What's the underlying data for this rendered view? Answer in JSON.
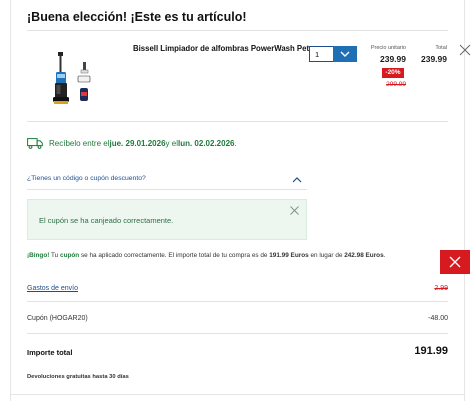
{
  "header": {
    "title": "¡Buena elección! ¡Este es tu artículo!"
  },
  "product": {
    "name": "Bissell Limpiador de alfombras PowerWash Pet",
    "image_icon": "carpet-cleaner-image",
    "quantity": "1",
    "unit_price_label": "Precio unitario",
    "unit_price": "239.99",
    "discount_badge": "-20%",
    "original_price": "299.99",
    "total_label": "Total",
    "total_price": "239.99"
  },
  "delivery": {
    "prefix": "Recíbelo entre el ",
    "date_from": "jue. 29.01.2026",
    "middle": " y el ",
    "date_to": "lun. 02.02.2026",
    "suffix": "."
  },
  "coupon": {
    "toggle_label": "¿Tienes un código o cupón descuento?",
    "success_message": "El cupón se ha canjeado correctamente."
  },
  "bingo": {
    "lead": "¡Bingo!",
    "part1": " Tu ",
    "cupon_word": "cupón",
    "part2": " se ha aplicado correctamente. El importe total de tu compra es de ",
    "new_total": "191.99 Euros",
    "part3": " en lugar de ",
    "old_total": "242.98 Euros",
    "part4": "."
  },
  "summary": {
    "shipping_label": "Gastos de envío",
    "shipping_value": "2.99",
    "coupon_label": "Cupón (HOGAR20)",
    "coupon_value": "-48.00",
    "total_label": "Importe total",
    "total_value": "191.99",
    "returns_note": "Devoluciones gratuitas hasta 30 días"
  },
  "colors": {
    "accent_blue": "#1f6fb5",
    "sale_red": "#d71920",
    "success_green": "#1f7a3a"
  }
}
